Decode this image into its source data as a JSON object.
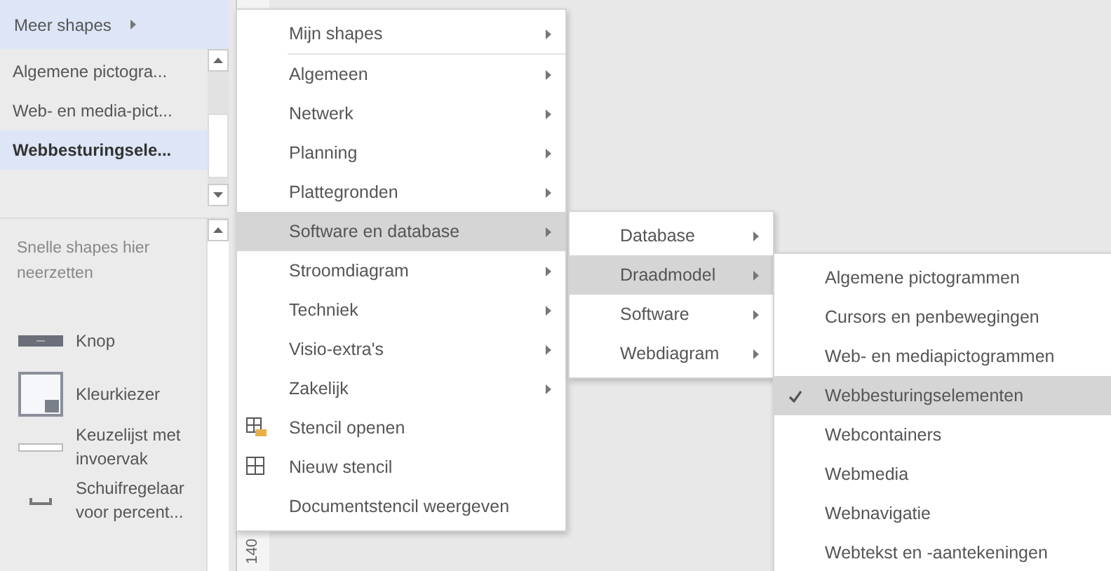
{
  "shapes_panel": {
    "more_shapes": {
      "label": "Meer shapes",
      "selected": true
    },
    "stencils": [
      {
        "label": "Algemene pictogra...",
        "selected": false
      },
      {
        "label": "Web- en media-pict...",
        "selected": false
      },
      {
        "label": "Webbesturingsele...",
        "selected": true
      }
    ],
    "quick_hint": "Snelle shapes hier neerzetten",
    "quick_shapes": [
      {
        "label": "Knop",
        "kind": "button"
      },
      {
        "label": "Kleurkiezer",
        "kind": "color-picker"
      },
      {
        "label": "Keuzelijst met invoervak",
        "kind": "combo"
      },
      {
        "label": "Schuifregelaar voor percent...",
        "kind": "slider"
      }
    ]
  },
  "ruler": {
    "label": "140"
  },
  "menu": {
    "items": [
      {
        "label": "Mijn shapes",
        "kind": "submenu",
        "selected": false
      },
      {
        "label": "Algemeen",
        "kind": "submenu",
        "selected": false
      },
      {
        "label": "Netwerk",
        "kind": "submenu",
        "selected": false
      },
      {
        "label": "Planning",
        "kind": "submenu",
        "selected": false
      },
      {
        "label": "Plattegronden",
        "kind": "submenu",
        "selected": false
      },
      {
        "label": "Software en database",
        "kind": "submenu",
        "selected": true
      },
      {
        "label": "Stroomdiagram",
        "kind": "submenu",
        "selected": false
      },
      {
        "label": "Techniek",
        "kind": "submenu",
        "selected": false
      },
      {
        "label": "Visio-extra's",
        "kind": "submenu",
        "selected": false
      },
      {
        "label": "Zakelijk",
        "kind": "submenu",
        "selected": false
      },
      {
        "label": "Stencil openen",
        "kind": "open",
        "selected": false
      },
      {
        "label": "Nieuw stencil",
        "kind": "new",
        "selected": false
      },
      {
        "label": "Documentstencil weergeven",
        "kind": "command",
        "selected": false
      }
    ]
  },
  "submenu": {
    "items": [
      {
        "label": "Database",
        "selected": false
      },
      {
        "label": "Draadmodel",
        "selected": true
      },
      {
        "label": "Software",
        "selected": false
      },
      {
        "label": "Webdiagram",
        "selected": false
      }
    ]
  },
  "stencil_menu": {
    "items": [
      {
        "label": "Algemene pictogrammen",
        "checked": false
      },
      {
        "label": "Cursors en penbewegingen",
        "checked": false
      },
      {
        "label": "Web- en mediapictogrammen",
        "checked": false
      },
      {
        "label": "Webbesturingselementen",
        "checked": true
      },
      {
        "label": "Webcontainers",
        "checked": false
      },
      {
        "label": "Webmedia",
        "checked": false
      },
      {
        "label": "Webnavigatie",
        "checked": false
      },
      {
        "label": "Webtekst en -aantekeningen",
        "checked": false
      }
    ]
  }
}
